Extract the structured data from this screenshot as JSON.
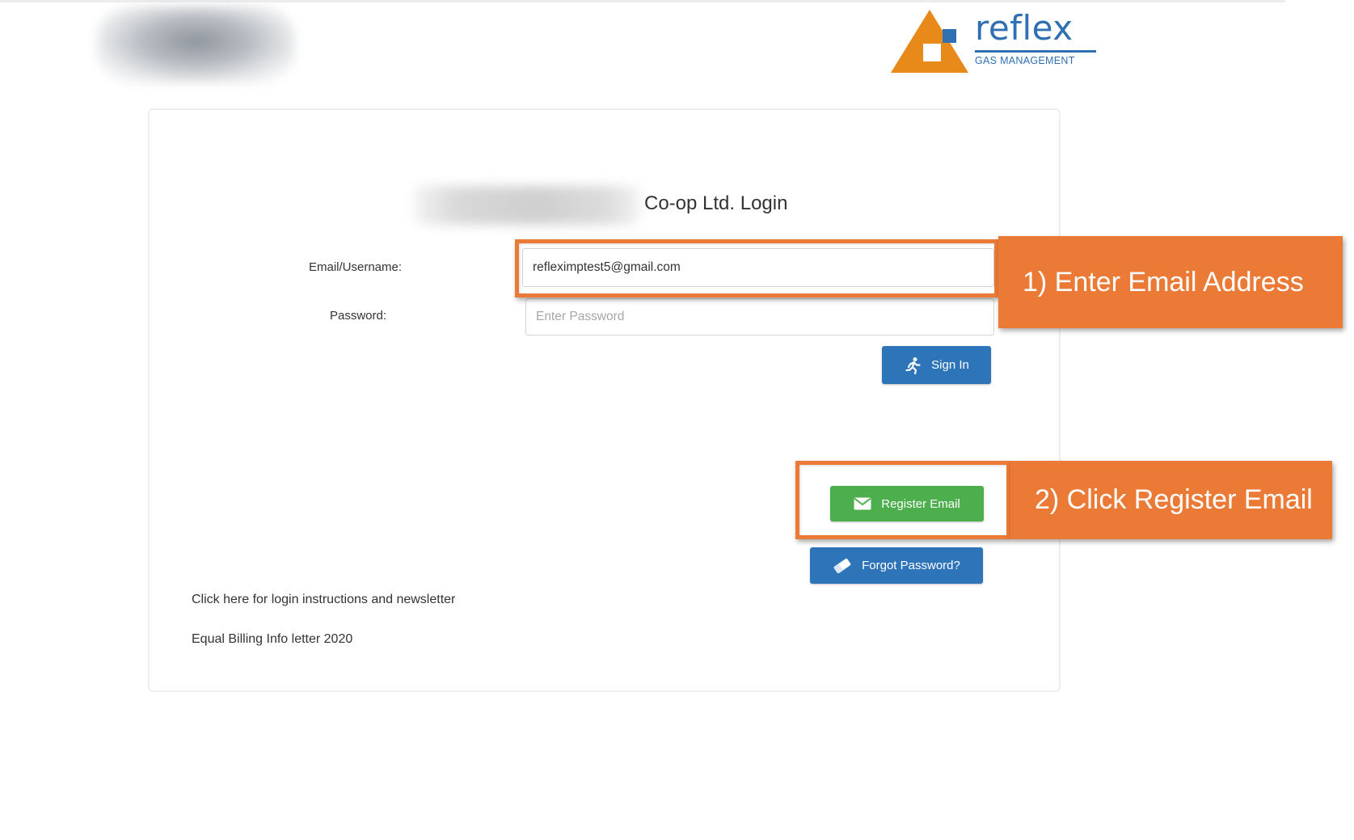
{
  "brand": {
    "name": "reflex",
    "tagline": "GAS MANAGEMENT",
    "colors": {
      "primary": "#2f6fb2",
      "accent": "#e88a1a"
    }
  },
  "login": {
    "title": "Co-op Ltd. Login",
    "email_label": "Email/Username:",
    "email_value": "refleximptest5@gmail.com",
    "password_label": "Password:",
    "password_placeholder": "Enter Password",
    "sign_in_label": "Sign In",
    "sign_in_icon": "running-person-icon",
    "register_label": "Register Email",
    "register_icon": "envelope-icon",
    "forgot_label": "Forgot Password?",
    "forgot_icon": "eraser-icon"
  },
  "links": [
    {
      "label": "Click here for login instructions and newsletter"
    },
    {
      "label": "Equal Billing Info letter 2020"
    }
  ],
  "annotations": [
    {
      "label": "1) Enter Email Address"
    },
    {
      "label": "2) Click Register Email"
    }
  ],
  "colors": {
    "callout": "#ea7a36",
    "sign_in_button": "#2e74b8",
    "register_button": "#4cae4c",
    "forgot_button": "#2e74b8"
  }
}
